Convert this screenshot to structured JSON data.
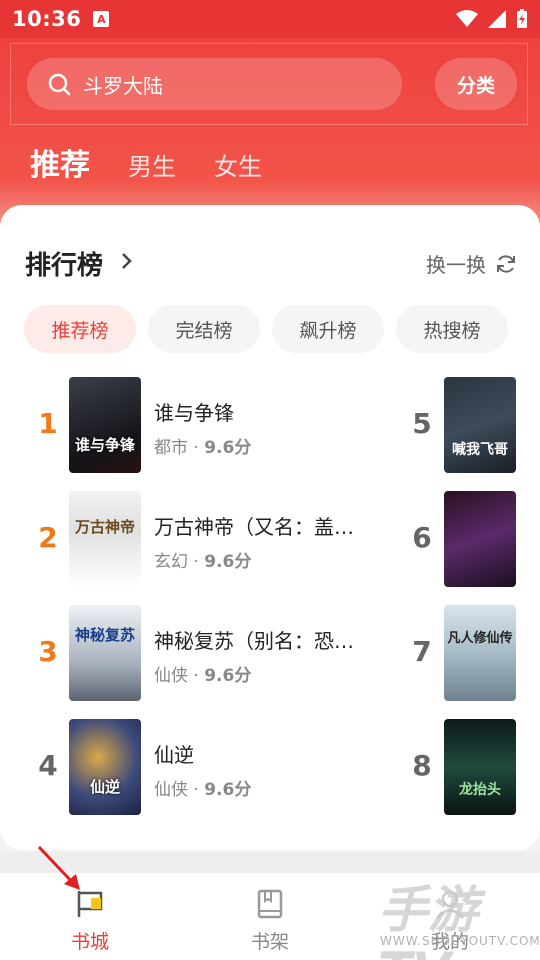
{
  "status_bar": {
    "time": "10:36",
    "app_icon": "A"
  },
  "search": {
    "placeholder": "斗罗大陆",
    "category_label": "分类"
  },
  "top_tabs": [
    {
      "label": "推荐",
      "active": true
    },
    {
      "label": "男生",
      "active": false
    },
    {
      "label": "女生",
      "active": false
    }
  ],
  "ranking": {
    "title": "排行榜",
    "refresh_label": "换一换",
    "chips": [
      {
        "label": "推荐榜",
        "active": true
      },
      {
        "label": "完结榜",
        "active": false
      },
      {
        "label": "飙升榜",
        "active": false
      },
      {
        "label": "热搜榜",
        "active": false
      }
    ],
    "left_items": [
      {
        "rank": "1",
        "title": "谁与争锋",
        "genre": "都市",
        "score": "9.6分",
        "cover_text": "谁与争锋",
        "rank_color": "#f07a1a"
      },
      {
        "rank": "2",
        "title": "万古神帝（又名：盖…",
        "genre": "玄幻",
        "score": "9.6分",
        "cover_text": "万古神帝",
        "rank_color": "#f07a1a"
      },
      {
        "rank": "3",
        "title": "神秘复苏（别名：恐…",
        "genre": "仙侠",
        "score": "9.6分",
        "cover_text": "神秘复苏",
        "rank_color": "#f07a1a"
      },
      {
        "rank": "4",
        "title": "仙逆",
        "genre": "仙侠",
        "score": "9.6分",
        "cover_text": "仙逆",
        "rank_color": "#666666"
      }
    ],
    "right_items": [
      {
        "rank": "5",
        "cover_text": "喊我飞哥"
      },
      {
        "rank": "6",
        "cover_text": ""
      },
      {
        "rank": "7",
        "cover_text": "凡人修仙传"
      },
      {
        "rank": "8",
        "cover_text": "龙抬头"
      }
    ]
  },
  "bottom_nav": [
    {
      "label": "书城",
      "icon": "flag-icon",
      "active": true
    },
    {
      "label": "书架",
      "icon": "book-icon",
      "active": false
    },
    {
      "label": "我的",
      "icon": "person-icon",
      "active": false
    }
  ],
  "watermark": {
    "big": "手游TV",
    "small": "WWW.SHOUYOUTV.COM"
  },
  "colors": {
    "accent": "#e9403a",
    "header": "#ec3c3c"
  }
}
